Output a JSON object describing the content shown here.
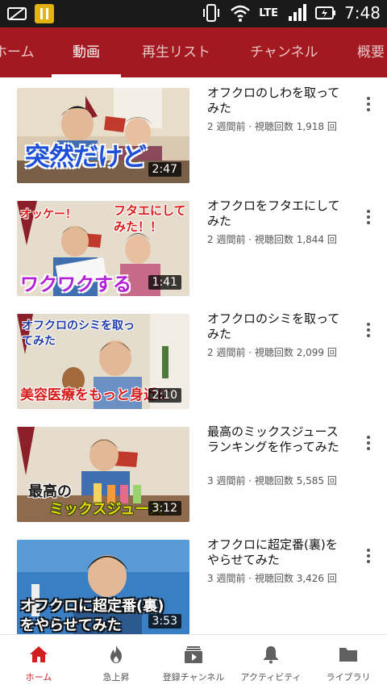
{
  "status": {
    "time": "7:48",
    "network": "LTE"
  },
  "tabs": [
    {
      "label": "ホーム"
    },
    {
      "label": "動画"
    },
    {
      "label": "再生リスト"
    },
    {
      "label": "チャンネル"
    },
    {
      "label": "概要"
    }
  ],
  "videos": [
    {
      "title": "オフクロのしわを取ってみた",
      "meta": "2 週間前 · 視聴回数 1,918 回",
      "duration": "2:47",
      "caption": "突然だけど"
    },
    {
      "title": "オフクロをフタエにしてみた",
      "meta": "2 週間前 · 視聴回数 1,844 回",
      "duration": "1:41",
      "caption": "ワクワクする",
      "caption2": "オッケー！",
      "caption3": "フタエにしてみた！！"
    },
    {
      "title": "オフクロのシミを取ってみた",
      "meta": "2 週間前 · 視聴回数 2,099 回",
      "duration": "2:10",
      "caption": "美容医療をもっと身近に",
      "caption2": "オフクロのシミを取ってみた"
    },
    {
      "title": "最高のミックスジュースランキングを作ってみた",
      "meta": "3 週間前 · 視聴回数 5,585 回",
      "duration": "3:12",
      "caption": "最高の",
      "caption2": "ミックスジュース"
    },
    {
      "title": "オフクロに超定番(裏)をやらせてみた",
      "meta": "3 週間前 · 視聴回数 3,426 回",
      "duration": "3:53",
      "caption": "オフクロに超定番(裏)",
      "caption2": "をやらせてみた"
    }
  ],
  "bottom_nav": [
    {
      "label": "ホーム",
      "icon": "home-icon"
    },
    {
      "label": "急上昇",
      "icon": "flame-icon"
    },
    {
      "label": "登録チャンネル",
      "icon": "subscriptions-icon"
    },
    {
      "label": "アクティビティ",
      "icon": "bell-icon"
    },
    {
      "label": "ライブラリ",
      "icon": "folder-icon"
    }
  ],
  "colors": {
    "header": "#a3191f",
    "active_nav": "#d21f1f"
  }
}
